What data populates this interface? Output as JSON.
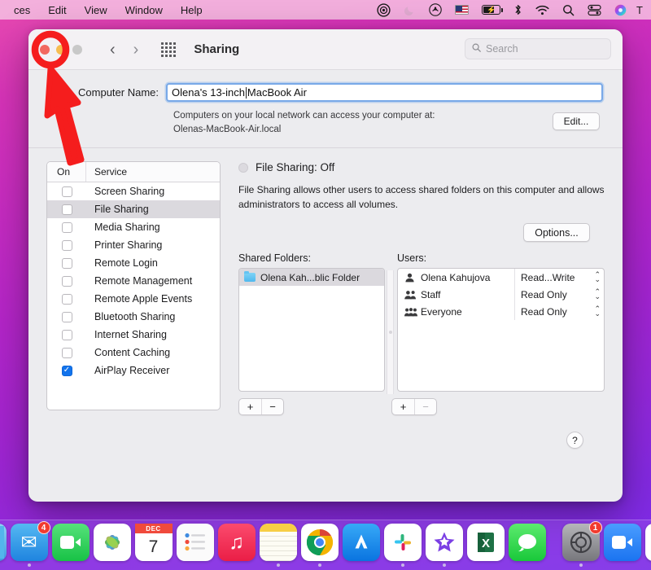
{
  "menubar": {
    "items": [
      {
        "label": "ces",
        "name": "menu-app-name"
      },
      {
        "label": "Edit",
        "name": "menu-edit"
      },
      {
        "label": "View",
        "name": "menu-view"
      },
      {
        "label": "Window",
        "name": "menu-window"
      },
      {
        "label": "Help",
        "name": "menu-help"
      }
    ],
    "status_icons": [
      {
        "name": "screen-recording-icon",
        "glyph": "◎"
      },
      {
        "name": "do-not-disturb-moon-icon",
        "glyph": "☾"
      },
      {
        "name": "airdrop-icon",
        "glyph": "◉"
      },
      {
        "name": "us-flag-input-icon",
        "glyph": ""
      },
      {
        "name": "battery-charging-icon",
        "glyph": "⚡"
      },
      {
        "name": "bluetooth-icon",
        "glyph": "✳"
      },
      {
        "name": "wifi-icon",
        "glyph": "≋"
      },
      {
        "name": "spotlight-search-icon",
        "glyph": "⌕"
      },
      {
        "name": "control-center-icon",
        "glyph": "⊟"
      },
      {
        "name": "siri-icon",
        "glyph": "●"
      },
      {
        "name": "time-text-icon",
        "glyph": "T"
      }
    ]
  },
  "window": {
    "title": "Sharing",
    "traffic_lights": {
      "close": "close",
      "minimize": "minimize",
      "zoom": "zoom"
    },
    "nav": {
      "back": "‹",
      "forward": "›"
    },
    "grid_button": "show-all",
    "search": {
      "placeholder": "Search",
      "value": "",
      "icon": "⌕"
    }
  },
  "computer_name": {
    "label": "Computer Name:",
    "value_before_caret": "Olena's 13-inch ",
    "value_after_caret": "MacBook Air",
    "full_value": "Olena's 13-inch MacBook Air",
    "description_line1": "Computers on your local network can access your computer at:",
    "description_line2": "Olenas-MacBook-Air.local",
    "edit_button": "Edit..."
  },
  "services_table": {
    "header_on": "On",
    "header_service": "Service",
    "rows": [
      {
        "label": "Screen Sharing",
        "checked": false,
        "selected": false
      },
      {
        "label": "File Sharing",
        "checked": false,
        "selected": true
      },
      {
        "label": "Media Sharing",
        "checked": false,
        "selected": false
      },
      {
        "label": "Printer Sharing",
        "checked": false,
        "selected": false
      },
      {
        "label": "Remote Login",
        "checked": false,
        "selected": false
      },
      {
        "label": "Remote Management",
        "checked": false,
        "selected": false
      },
      {
        "label": "Remote Apple Events",
        "checked": false,
        "selected": false
      },
      {
        "label": "Bluetooth Sharing",
        "checked": false,
        "selected": false
      },
      {
        "label": "Internet Sharing",
        "checked": false,
        "selected": false
      },
      {
        "label": "Content Caching",
        "checked": false,
        "selected": false
      },
      {
        "label": "AirPlay Receiver",
        "checked": true,
        "selected": false
      }
    ],
    "check_glyph": "✓"
  },
  "detail": {
    "status_title": "File Sharing: Off",
    "description": "File Sharing allows other users to access shared folders on this computer and allows administrators to access all volumes.",
    "options_button": "Options...",
    "shared_folders_label": "Shared Folders:",
    "users_label": "Users:",
    "shared_folders": [
      {
        "name": "Olena Kah...blic Folder",
        "selected": true
      }
    ],
    "users": [
      {
        "name": "Olena Kahujova",
        "permission": "Read...Write",
        "icon": "single-user-icon",
        "glyph": "\u0001"
      },
      {
        "name": "Staff",
        "permission": "Read Only",
        "icon": "group-users-icon",
        "glyph": "\u0002"
      },
      {
        "name": "Everyone",
        "permission": "Read Only",
        "icon": "everyone-users-icon",
        "glyph": "\u0003"
      }
    ],
    "folder_add": "+",
    "folder_remove": "−",
    "user_add": "+",
    "user_remove": "−",
    "help_button": "?"
  },
  "dock": {
    "items": [
      {
        "name": "finder",
        "badge": "",
        "running": false,
        "bg": "#1e8fe0",
        "glyph": ""
      },
      {
        "name": "mail",
        "badge": "4",
        "running": true,
        "bg": "#2f9aec",
        "glyph": "✉"
      },
      {
        "name": "facetime",
        "badge": "",
        "running": false,
        "bg": "#2ece5a",
        "glyph": "▣"
      },
      {
        "name": "photos",
        "badge": "",
        "running": false,
        "bg": "#ffffff",
        "glyph": "✿"
      },
      {
        "name": "calendar",
        "badge": "",
        "running": false,
        "bg": "#ffffff",
        "glyph": "7"
      },
      {
        "name": "reminders",
        "badge": "",
        "running": false,
        "bg": "#ffffff",
        "glyph": "☰"
      },
      {
        "name": "music",
        "badge": "",
        "running": false,
        "bg": "#f43557",
        "glyph": "♫"
      },
      {
        "name": "notes",
        "badge": "",
        "running": true,
        "bg": "#fbfbf5",
        "glyph": ""
      },
      {
        "name": "chrome",
        "badge": "",
        "running": true,
        "bg": "#ffffff",
        "glyph": "◉"
      },
      {
        "name": "app-store",
        "badge": "",
        "running": false,
        "bg": "#1a8cf0",
        "glyph": "A"
      },
      {
        "name": "slack",
        "badge": "",
        "running": true,
        "bg": "#ffffff",
        "glyph": "✳"
      },
      {
        "name": "imovie",
        "badge": "",
        "running": true,
        "bg": "#ffffff",
        "glyph": "★"
      },
      {
        "name": "excel",
        "badge": "",
        "running": false,
        "bg": "#ffffff",
        "glyph": "X"
      },
      {
        "name": "messages",
        "badge": "",
        "running": false,
        "bg": "#3ad350",
        "glyph": "💬"
      },
      {
        "name": "system-preferences",
        "badge": "1",
        "running": true,
        "bg": "#9a9a9e",
        "glyph": "⚙"
      },
      {
        "name": "zoom",
        "badge": "",
        "running": false,
        "bg": "#2d8cff",
        "glyph": "▣"
      },
      {
        "name": "word",
        "badge": "",
        "running": false,
        "bg": "#ffffff",
        "glyph": "W"
      }
    ],
    "calendar_month": "DEC",
    "calendar_day": "7"
  },
  "annotation": {
    "type": "red-arrow-pointing-to-close-button",
    "color": "#f51d1d",
    "target": "close-button"
  }
}
